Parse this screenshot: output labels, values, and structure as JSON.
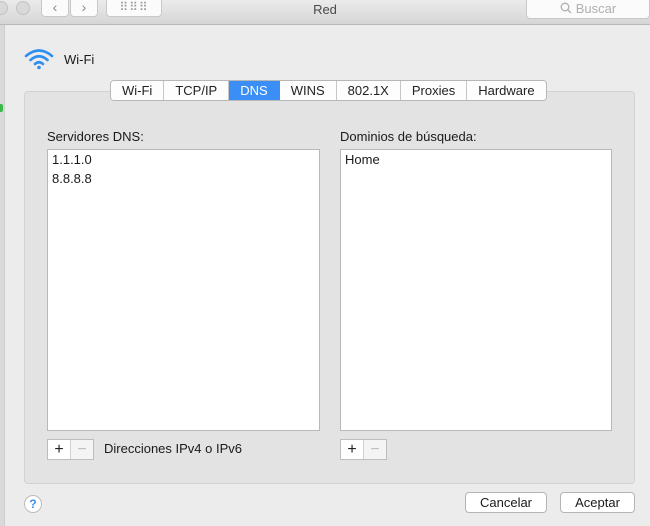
{
  "window": {
    "title": "Red"
  },
  "toolbar": {
    "back_icon": "‹",
    "forward_icon": "›",
    "grid_icon": "⠿⠿⠿",
    "search_placeholder": "Buscar"
  },
  "header": {
    "interface_name": "Wi-Fi"
  },
  "tabs": [
    {
      "label": "Wi-Fi"
    },
    {
      "label": "TCP/IP"
    },
    {
      "label": "DNS"
    },
    {
      "label": "WINS"
    },
    {
      "label": "802.1X"
    },
    {
      "label": "Proxies"
    },
    {
      "label": "Hardware"
    }
  ],
  "active_tab": "DNS",
  "dns": {
    "servers_label": "Servidores DNS:",
    "servers": [
      "1.1.1.0",
      "8.8.8.8"
    ],
    "hint": "Direcciones IPv4 o IPv6"
  },
  "search_domains": {
    "label": "Dominios de búsqueda:",
    "domains": [
      "Home"
    ]
  },
  "buttons": {
    "help": "?",
    "cancel": "Cancelar",
    "accept": "Aceptar",
    "add": "+",
    "remove": "−"
  },
  "colors": {
    "accent": "#3a8ef5",
    "wifi_icon": "#2f8ff0"
  }
}
